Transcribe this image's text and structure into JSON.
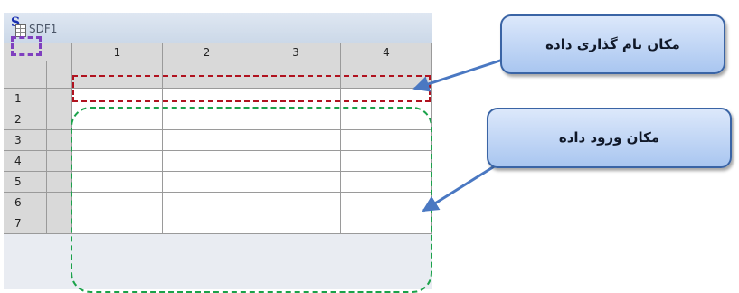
{
  "window": {
    "title": "SDF1",
    "icon": "spreadsheet-data-icon",
    "icon_letter": "S"
  },
  "grid": {
    "column_headers": [
      "1",
      "2",
      "3",
      "4"
    ],
    "row_headers": [
      "1",
      "2",
      "3",
      "4",
      "5",
      "6",
      "7"
    ]
  },
  "callouts": {
    "variable_name_area": "مکان نام گذاری داده",
    "data_entry_area": "مکان ورود داده"
  },
  "colors": {
    "corner_mark": "#7f3fbf",
    "variable_region": "#b0121f",
    "data_region": "#1aa24a",
    "callout_fill": "#bcd3f5",
    "callout_border": "#3a64a5",
    "arrow": "#4a78c2"
  }
}
